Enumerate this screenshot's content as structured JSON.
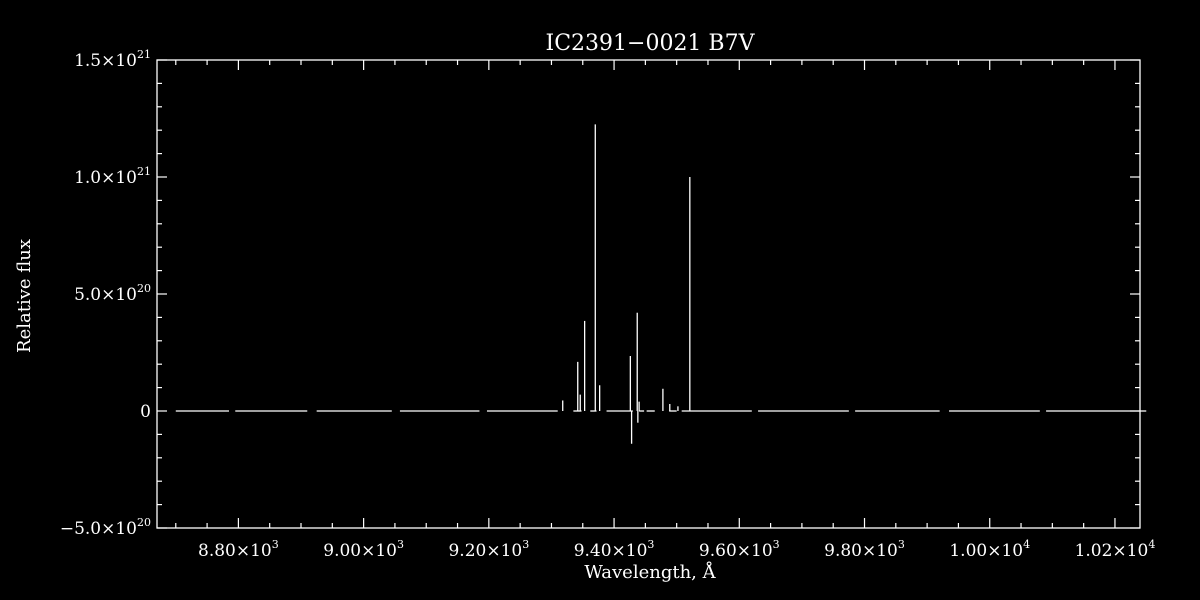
{
  "chart_data": {
    "type": "line",
    "title": "IC2391−0021   B7V",
    "xlabel": "Wavelength, Å",
    "ylabel": "Relative flux",
    "xlim": [
      8670,
      10240
    ],
    "ylim": [
      -5e+20,
      1.5e+21
    ],
    "x_ticks": [
      {
        "value": 8800,
        "mant": "8.80×10",
        "exp": "3"
      },
      {
        "value": 9000,
        "mant": "9.00×10",
        "exp": "3"
      },
      {
        "value": 9200,
        "mant": "9.20×10",
        "exp": "3"
      },
      {
        "value": 9400,
        "mant": "9.40×10",
        "exp": "3"
      },
      {
        "value": 9600,
        "mant": "9.60×10",
        "exp": "3"
      },
      {
        "value": 9800,
        "mant": "9.80×10",
        "exp": "3"
      },
      {
        "value": 10000,
        "mant": "1.00×10",
        "exp": "4"
      },
      {
        "value": 10200,
        "mant": "1.02×10",
        "exp": "4"
      }
    ],
    "y_ticks": [
      {
        "value": 1.5e+21,
        "mant": "1.5×10",
        "exp": "21"
      },
      {
        "value": 1e+21,
        "mant": "1.0×10",
        "exp": "21"
      },
      {
        "value": 5e+20,
        "mant": "5.0×10",
        "exp": "20"
      },
      {
        "value": 0,
        "mant": "0",
        "exp": ""
      },
      {
        "value": -5e+20,
        "mant": "−5.0×10",
        "exp": "20"
      }
    ],
    "baseline_segments": [
      [
        8700,
        8785
      ],
      [
        8795,
        8910
      ],
      [
        8925,
        9045
      ],
      [
        9058,
        9185
      ],
      [
        9197,
        9310
      ],
      [
        9335,
        9348
      ],
      [
        9362,
        9372
      ],
      [
        9388,
        9430
      ],
      [
        9440,
        9448
      ],
      [
        9452,
        9465
      ],
      [
        9488,
        9500
      ],
      [
        9508,
        9620
      ],
      [
        9630,
        9775
      ],
      [
        9785,
        9920
      ],
      [
        9935,
        10080
      ],
      [
        10090,
        10250
      ]
    ],
    "spikes": [
      {
        "x": 9318,
        "y": 4.5e+19
      },
      {
        "x": 9342,
        "y": 2.1e+20
      },
      {
        "x": 9346,
        "y": 7e+19
      },
      {
        "x": 9353,
        "y": 3.85e+20
      },
      {
        "x": 9370,
        "y": 1.225e+21
      },
      {
        "x": 9377,
        "y": 1.1e+20
      },
      {
        "x": 9426,
        "y": 2.35e+20
      },
      {
        "x": 9428,
        "y": -1.4e+20
      },
      {
        "x": 9437,
        "y": 4.2e+20
      },
      {
        "x": 9438,
        "y": -5e+19
      },
      {
        "x": 9440,
        "y": 4e+19
      },
      {
        "x": 9478,
        "y": 9.5e+19
      },
      {
        "x": 9489,
        "y": 3e+19
      },
      {
        "x": 9502,
        "y": 2e+19
      },
      {
        "x": 9521,
        "y": 1e+21
      }
    ]
  }
}
